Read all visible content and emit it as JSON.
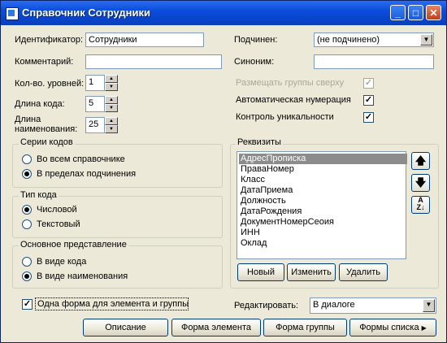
{
  "window": {
    "title": "Справочник Сотрудники"
  },
  "titlebar": {
    "minimize": "_",
    "maximize": "□",
    "close": "✕"
  },
  "form": {
    "id_label": "Идентификатор:",
    "id_value": "Сотрудники",
    "comment_label": "Комментарий:",
    "comment_value": "",
    "levels_label": "Кол-во. уровней:",
    "levels_value": "1",
    "code_len_label": "Длина кода:",
    "code_len_value": "5",
    "name_len_label_1": "Длина",
    "name_len_label_2": "наименования:",
    "name_len_value": "25",
    "sub_label": "Подчинен:",
    "sub_value": "(не подчинено)",
    "synonym_label": "Синоним:",
    "synonym_value": "",
    "groups_top_label": "Размещать группы сверху",
    "auto_num_label": "Автоматическая нумерация",
    "unique_label": "Контроль уникальности"
  },
  "series": {
    "title": "Серии кодов",
    "opt1": "Во всем справочнике",
    "opt2": "В пределах подчинения"
  },
  "code_type": {
    "title": "Тип кода",
    "opt1": "Числовой",
    "opt2": "Текстовый"
  },
  "presentation": {
    "title": "Основное представление",
    "opt1": "В виде кода",
    "opt2": "В виде наименования"
  },
  "requisites": {
    "title": "Реквизиты",
    "items": [
      "АдресПрописка",
      "ПраваНомер",
      "Класс",
      "ДатаПриема",
      "Должность",
      "ДатаРождения",
      "ДокументНомерСеоия",
      "ИНН",
      "Оклад"
    ],
    "new_btn": "Новый",
    "edit_btn": "Изменить",
    "delete_btn": "Удалить",
    "up_icon": "arrow-up-icon",
    "down_icon": "arrow-down-icon",
    "sort_icon": "sort-az-icon"
  },
  "bottom": {
    "one_form_label": "Одна форма для элемента и группы",
    "edit_label": "Редактировать:",
    "edit_value": "В диалоге",
    "description_btn": "Описание",
    "element_form_btn": "Форма элемента",
    "group_form_btn": "Форма группы",
    "list_forms_btn": "Формы списка"
  }
}
